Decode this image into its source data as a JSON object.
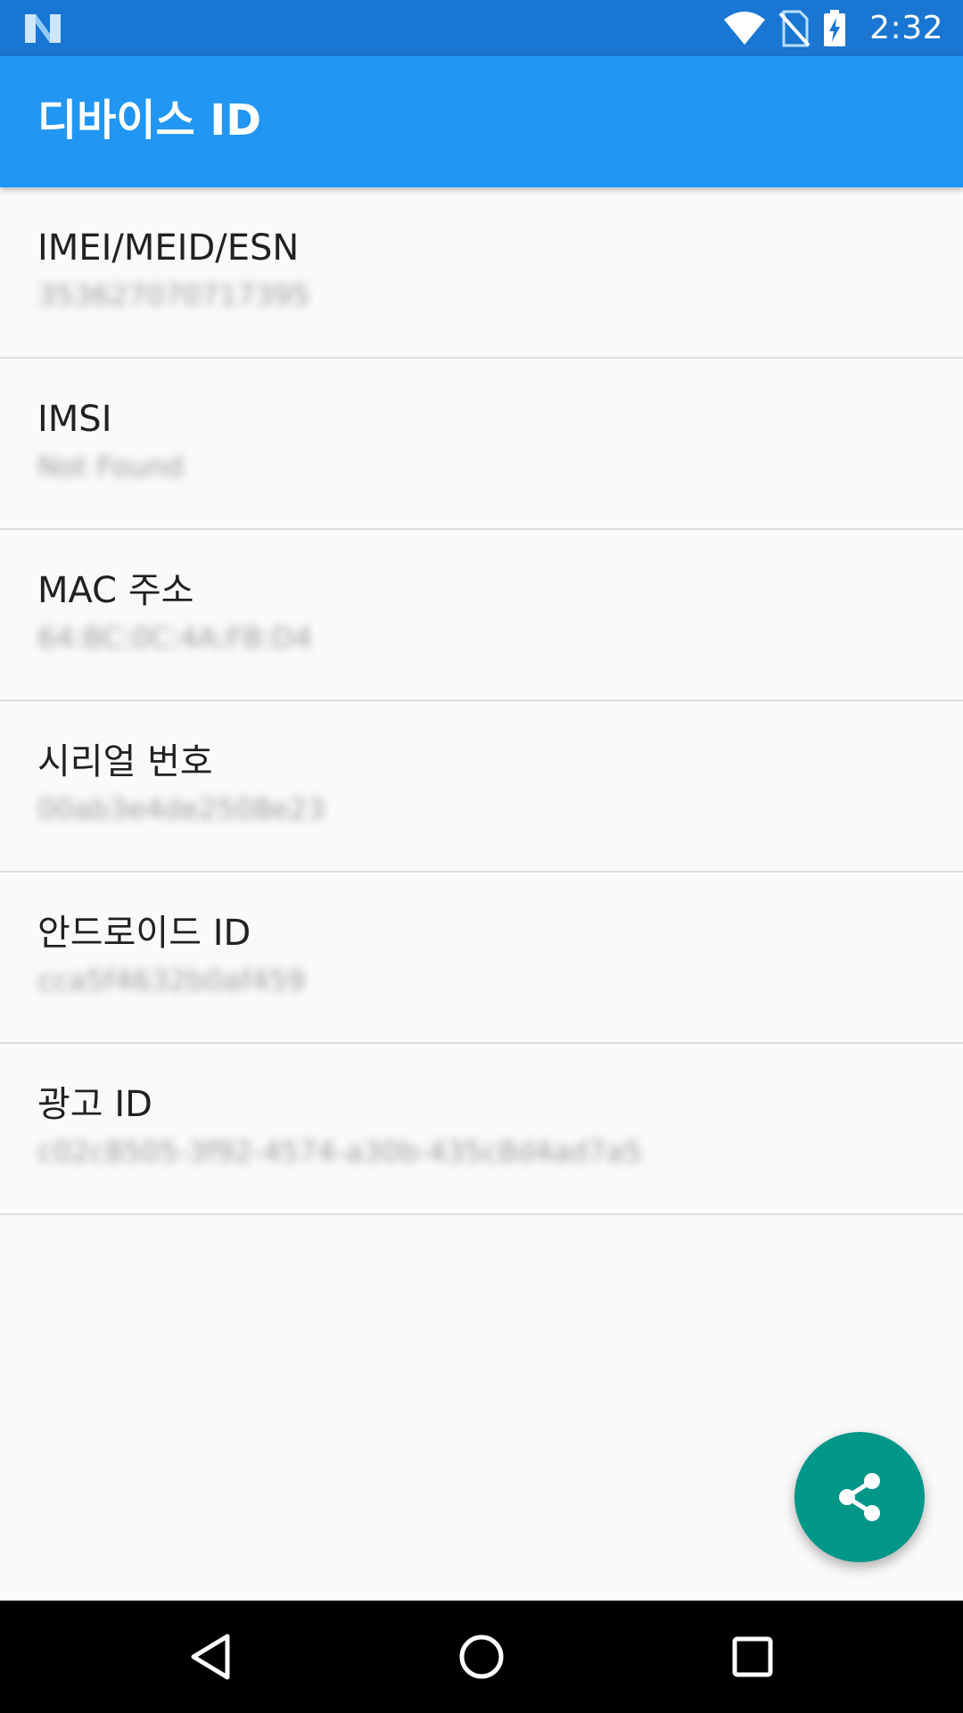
{
  "status_bar": {
    "time": "2:32",
    "icons": [
      "notification-n-icon",
      "wifi-icon",
      "no-sim-icon",
      "battery-charging-icon"
    ],
    "background_color": "#1976d2"
  },
  "app_bar": {
    "title": "디바이스 ID",
    "background_color": "#2196f3"
  },
  "items": [
    {
      "title": "IMEI/MEID/ESN",
      "value": "353627070717395"
    },
    {
      "title": "IMSI",
      "value": "Not Found"
    },
    {
      "title": "MAC 주소",
      "value": "64:BC:0C:4A:FB:D4"
    },
    {
      "title": "시리얼 번호",
      "value": "00ab3e4de2508e23"
    },
    {
      "title": "안드로이드 ID",
      "value": "cca5f4632b0af459"
    },
    {
      "title": "광고 ID",
      "value": "c02c8505-3f92-4574-a30b-435c8d4ad7a5"
    }
  ],
  "fab": {
    "icon": "share-icon",
    "color": "#009688"
  },
  "nav_bar": {
    "icons": [
      "back-icon",
      "home-icon",
      "recents-icon"
    ]
  }
}
